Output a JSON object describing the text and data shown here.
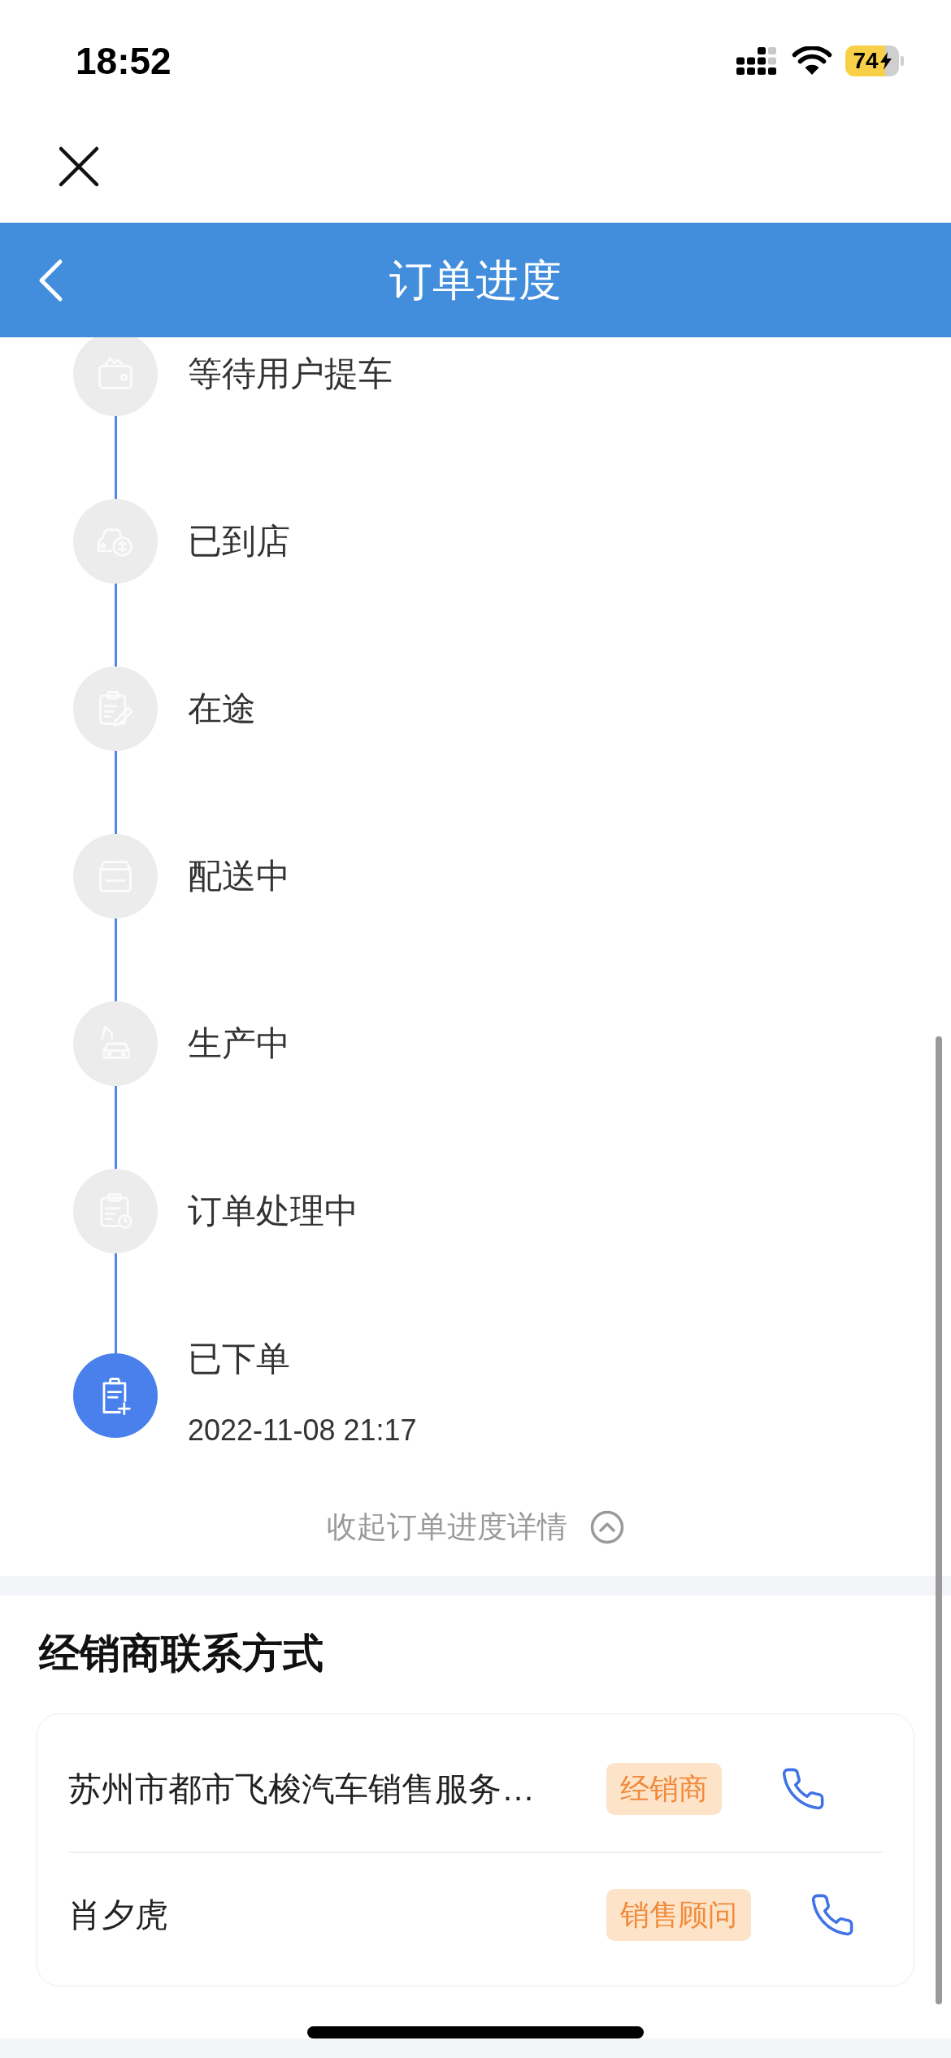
{
  "status_bar": {
    "time": "18:52",
    "battery": "74"
  },
  "header": {
    "title": "订单进度"
  },
  "timeline": {
    "steps": [
      {
        "label": "等待用户提车",
        "completed": false
      },
      {
        "label": "已到店",
        "completed": false
      },
      {
        "label": "在途",
        "completed": false
      },
      {
        "label": "配送中",
        "completed": false
      },
      {
        "label": "生产中",
        "completed": false
      },
      {
        "label": "订单处理中",
        "completed": false
      },
      {
        "label": "已下单",
        "time": "2022-11-08 21:17",
        "completed": true
      }
    ],
    "collapse_label": "收起订单进度详情"
  },
  "dealer_contact": {
    "title": "经销商联系方式",
    "contacts": [
      {
        "name": "苏州市都市飞梭汽车销售服务…",
        "role": "经销商"
      },
      {
        "name": "肖夕虎",
        "role": "销售顾问"
      }
    ]
  }
}
